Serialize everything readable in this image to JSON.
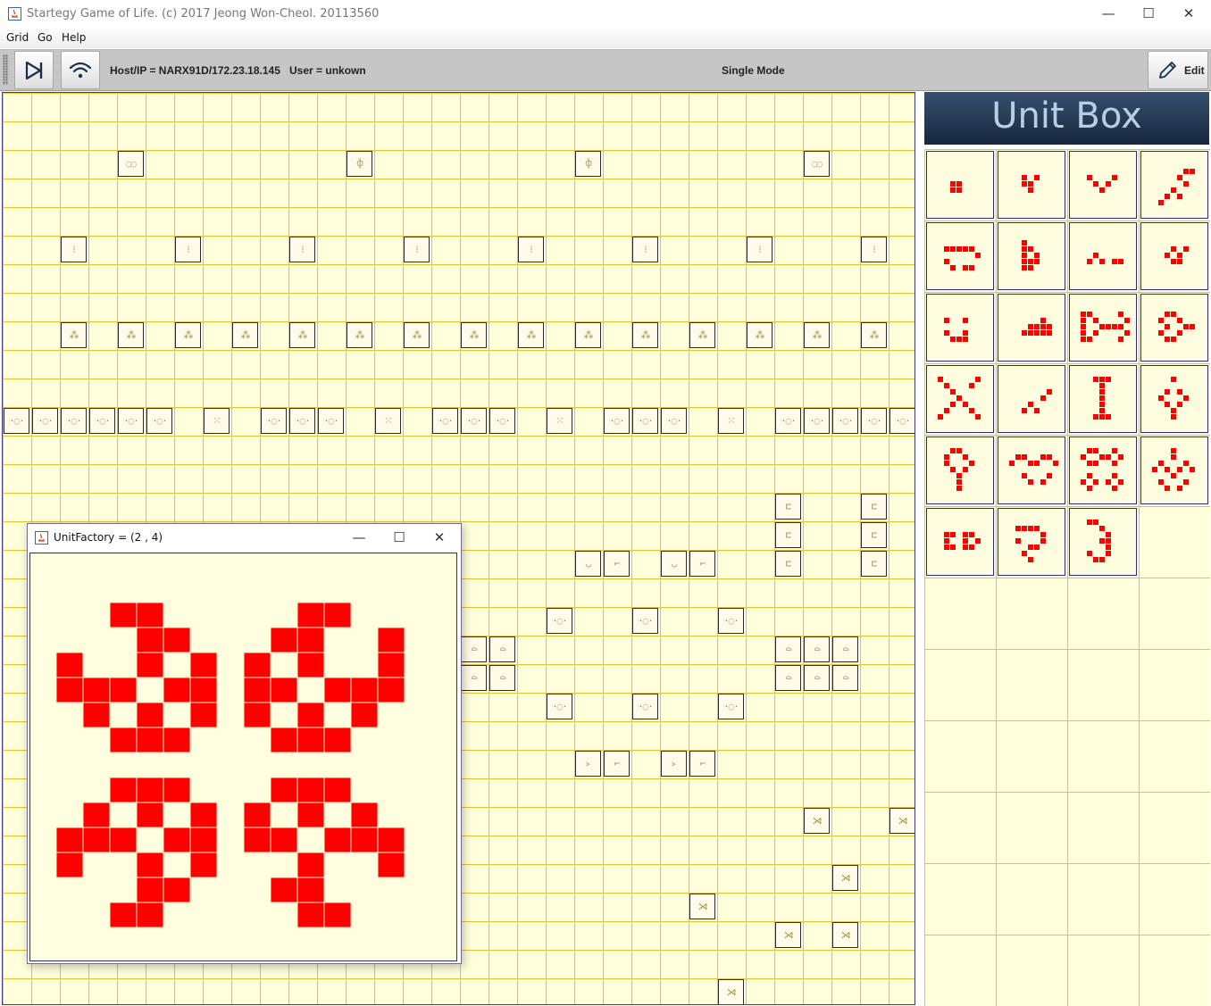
{
  "window": {
    "title": "Startegy Game of Life. (c) 2017 Jeong Won-Cheol. 20113560",
    "minimize_glyph": "—",
    "maximize_glyph": "☐",
    "close_glyph": "✕"
  },
  "menu": {
    "grid": "Grid",
    "go": "Go",
    "help": "Help"
  },
  "toolbar": {
    "host_ip": "Host/IP = NARX91D/172.23.18.145",
    "user": "User = unkown",
    "mode": "Single Mode",
    "edit_label": "Edit",
    "play_icon": "step-play-icon",
    "network_icon": "wifi-icon",
    "edit_icon": "pencil-icon"
  },
  "colors": {
    "board_bg": "#ffffdb",
    "grid_line": "#edc230",
    "live_cell": "#ff0000",
    "header_bg": "#1d3350"
  },
  "unit_box": {
    "title": "Unit Box"
  },
  "unit_factory": {
    "title": "UnitFactory = (2 , 4)",
    "minimize_glyph": "—",
    "maximize_glyph": "☐",
    "close_glyph": "✕"
  }
}
